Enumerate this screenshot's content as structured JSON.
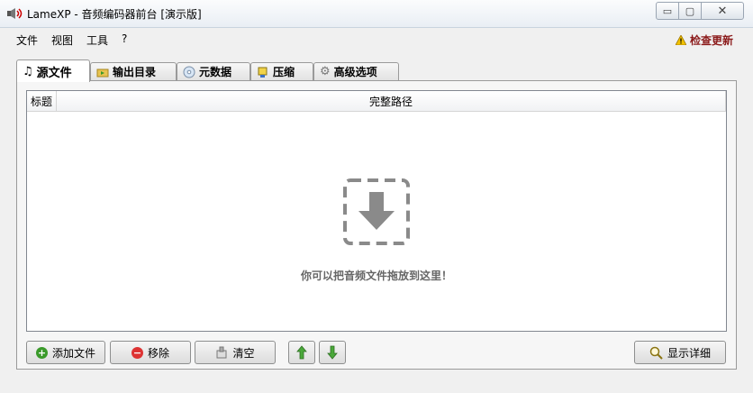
{
  "window": {
    "title": "LameXP - 音频编码器前台 [演示版]"
  },
  "menu": {
    "items": [
      "文件",
      "视图",
      "工具",
      "?"
    ],
    "update_label": "检查更新"
  },
  "tabs": [
    {
      "label": "源文件",
      "active": true,
      "icon": "music-note-icon"
    },
    {
      "label": "输出目录",
      "active": false,
      "icon": "folder-arrow-icon"
    },
    {
      "label": "元数据",
      "active": false,
      "icon": "cd-icon"
    },
    {
      "label": "压缩",
      "active": false,
      "icon": "vise-icon"
    },
    {
      "label": "高级选项",
      "active": false,
      "icon": "gear-icon"
    }
  ],
  "list": {
    "columns": [
      "标题",
      "完整路径"
    ],
    "empty_hint": "你可以把音频文件拖放到这里！"
  },
  "buttons": {
    "add": "添加文件",
    "remove": "移除",
    "clear": "清空",
    "details": "显示详细"
  },
  "colors": {
    "accent_update": "#8b1a1a",
    "green": "#3a9a2a",
    "red": "#d33"
  }
}
